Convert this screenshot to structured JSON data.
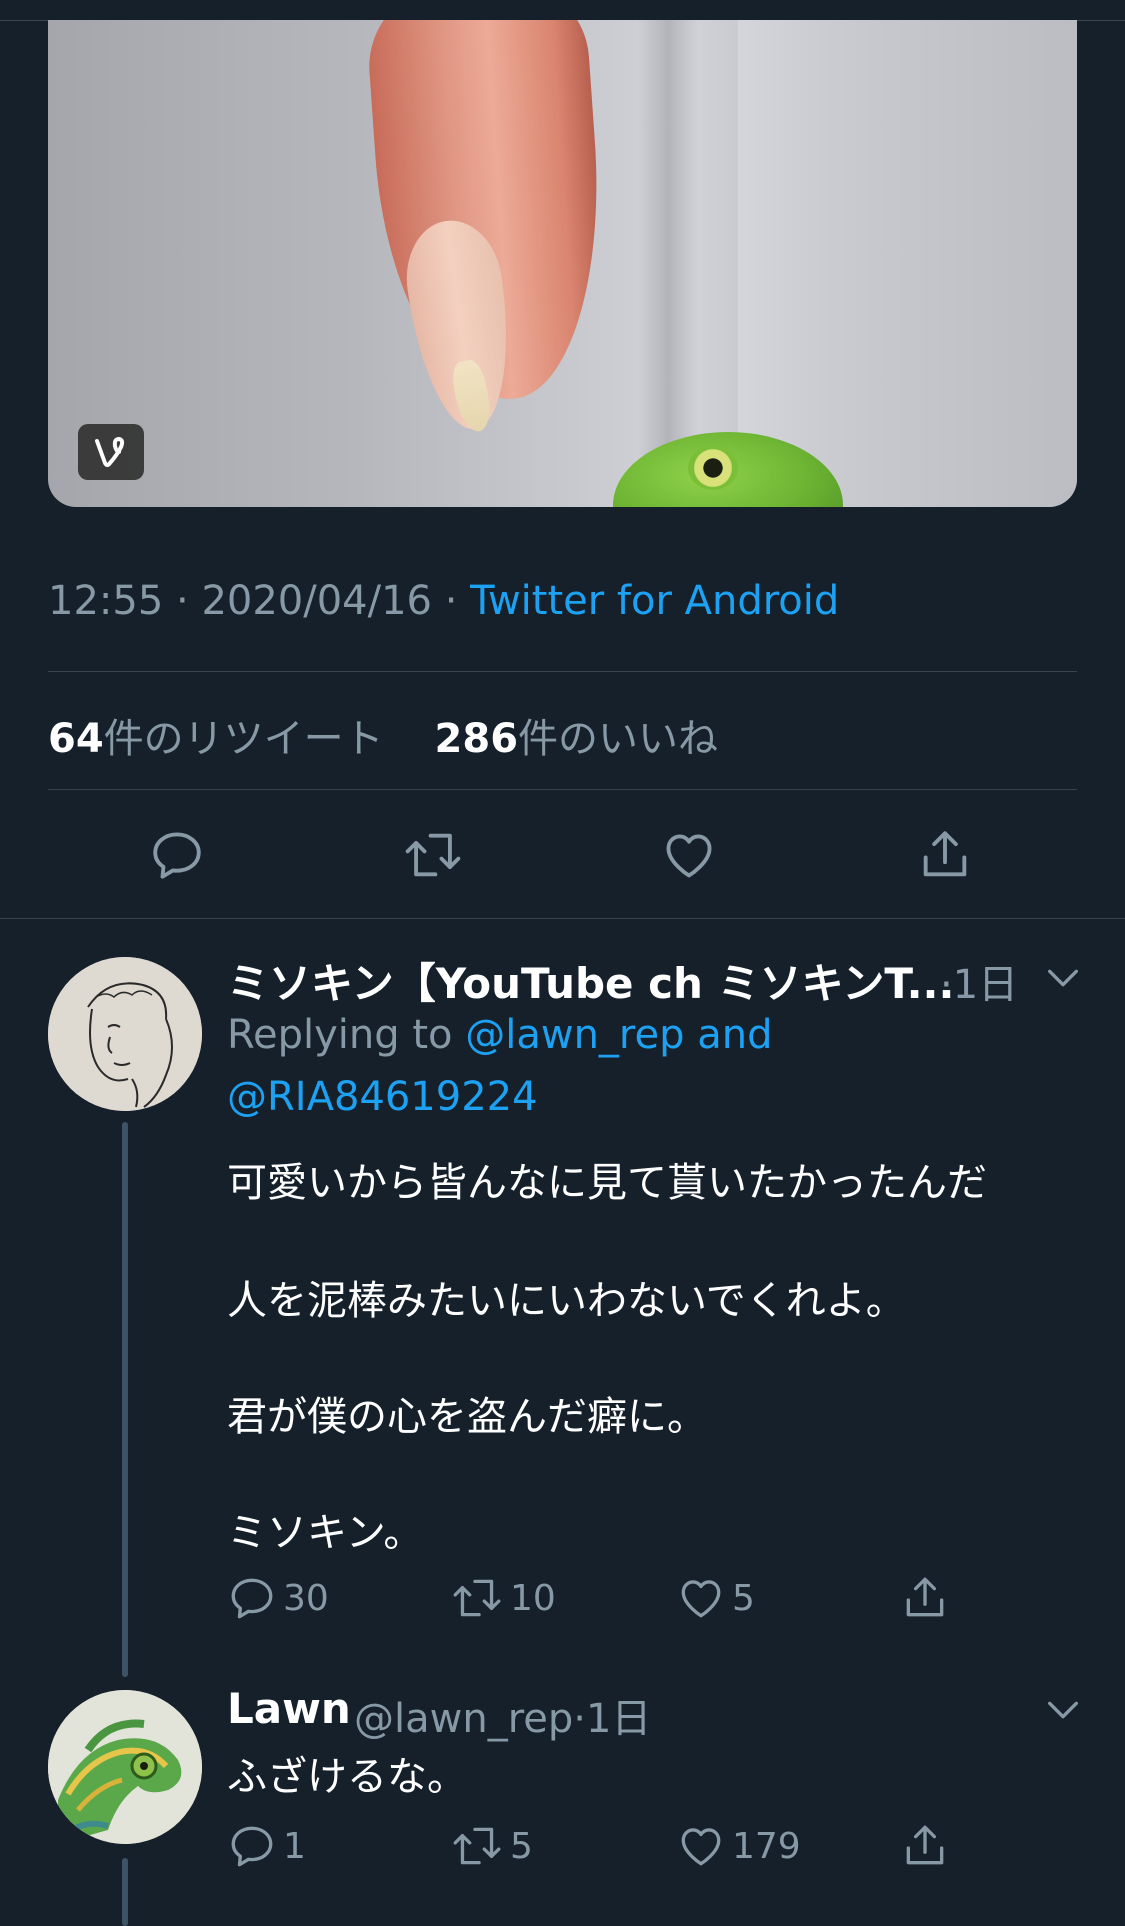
{
  "tweet": {
    "time": "12:55",
    "date": "2020/04/16",
    "separator": "·",
    "client": "Twitter for Android",
    "retweet_count": "64",
    "retweet_label": "件のリツイート",
    "like_count": "286",
    "like_label": "件のいいね",
    "media_badge": "vine-icon"
  },
  "replies": [
    {
      "name": "ミソキン【YouTube ch ミソキンT...",
      "age": "·1日",
      "replying_prefix": "Replying to",
      "replying_to_1": "@lawn_rep and",
      "replying_to_2": "@RIA84619224",
      "lines": [
        "可愛いから皆んなに見て貰いたかったんだ",
        "人を泥棒みたいにいわないでくれよ。",
        "君が僕の心を盗んだ癖に。",
        "ミソキン。"
      ],
      "reply_count": "30",
      "retweet_count": "10",
      "like_count": "5"
    },
    {
      "name": "Lawn",
      "handle": "@lawn_rep",
      "age": "·1日",
      "text": "ふざけるな。",
      "reply_count": "1",
      "retweet_count": "5",
      "like_count": "179"
    }
  ],
  "colors": {
    "background": "#15202b",
    "accent": "#1da1f2",
    "muted": "#8899a6",
    "divider": "#38444d"
  }
}
